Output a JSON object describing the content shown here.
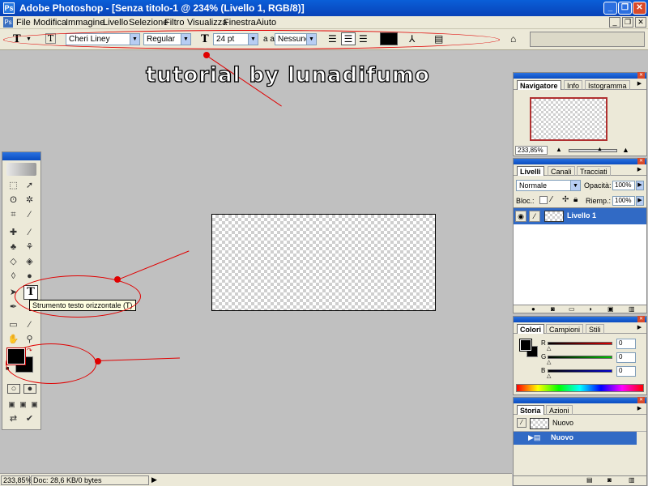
{
  "window": {
    "title": "Adobe Photoshop - [Senza titolo-1 @ 234% (Livello 1, RGB/8)]"
  },
  "menu": {
    "items": [
      "File",
      "Modifica",
      "Immagine",
      "Livello",
      "Selezione",
      "Filtro",
      "Visualizza",
      "Finestra",
      "Aiuto"
    ]
  },
  "options": {
    "font_family": "Cheri Liney",
    "font_style": "Regular",
    "font_size": "24 pt",
    "antialias_label": "a a",
    "antialias": "Nessuno",
    "text_color": "#000000"
  },
  "banner": {
    "text": "tutorial by lunadifumo"
  },
  "tooltip": {
    "text": "Strumento testo orizzontale (T)"
  },
  "navigator": {
    "tabs": [
      "Navigatore",
      "Info",
      "Istogramma"
    ],
    "zoom": "233,85%"
  },
  "layers": {
    "tabs": [
      "Livelli",
      "Canali",
      "Tracciati"
    ],
    "blend_mode": "Normale",
    "opacity_label": "Opacità:",
    "opacity": "100%",
    "lock_label": "Bloc.:",
    "fill_label": "Riemp.:",
    "fill": "100%",
    "layer_name": "Livello 1"
  },
  "colors": {
    "tabs": [
      "Colori",
      "Campioni",
      "Stili"
    ],
    "channels": [
      {
        "label": "R",
        "value": "0",
        "color": "#e00000"
      },
      {
        "label": "G",
        "value": "0",
        "color": "#00c000"
      },
      {
        "label": "B",
        "value": "0",
        "color": "#0000d0"
      }
    ]
  },
  "history": {
    "tabs": [
      "Storia",
      "Azioni"
    ],
    "items": [
      "Nuovo",
      "Nuovo"
    ]
  },
  "status": {
    "zoom": "233,85%",
    "doc": "Doc: 28,6 KB/0 bytes"
  },
  "colors_theme": {
    "accent": "#0a4cc0",
    "annotation": "#e00000",
    "panel_bg": "#ece9d8",
    "workspace": "#c0c0c0"
  }
}
